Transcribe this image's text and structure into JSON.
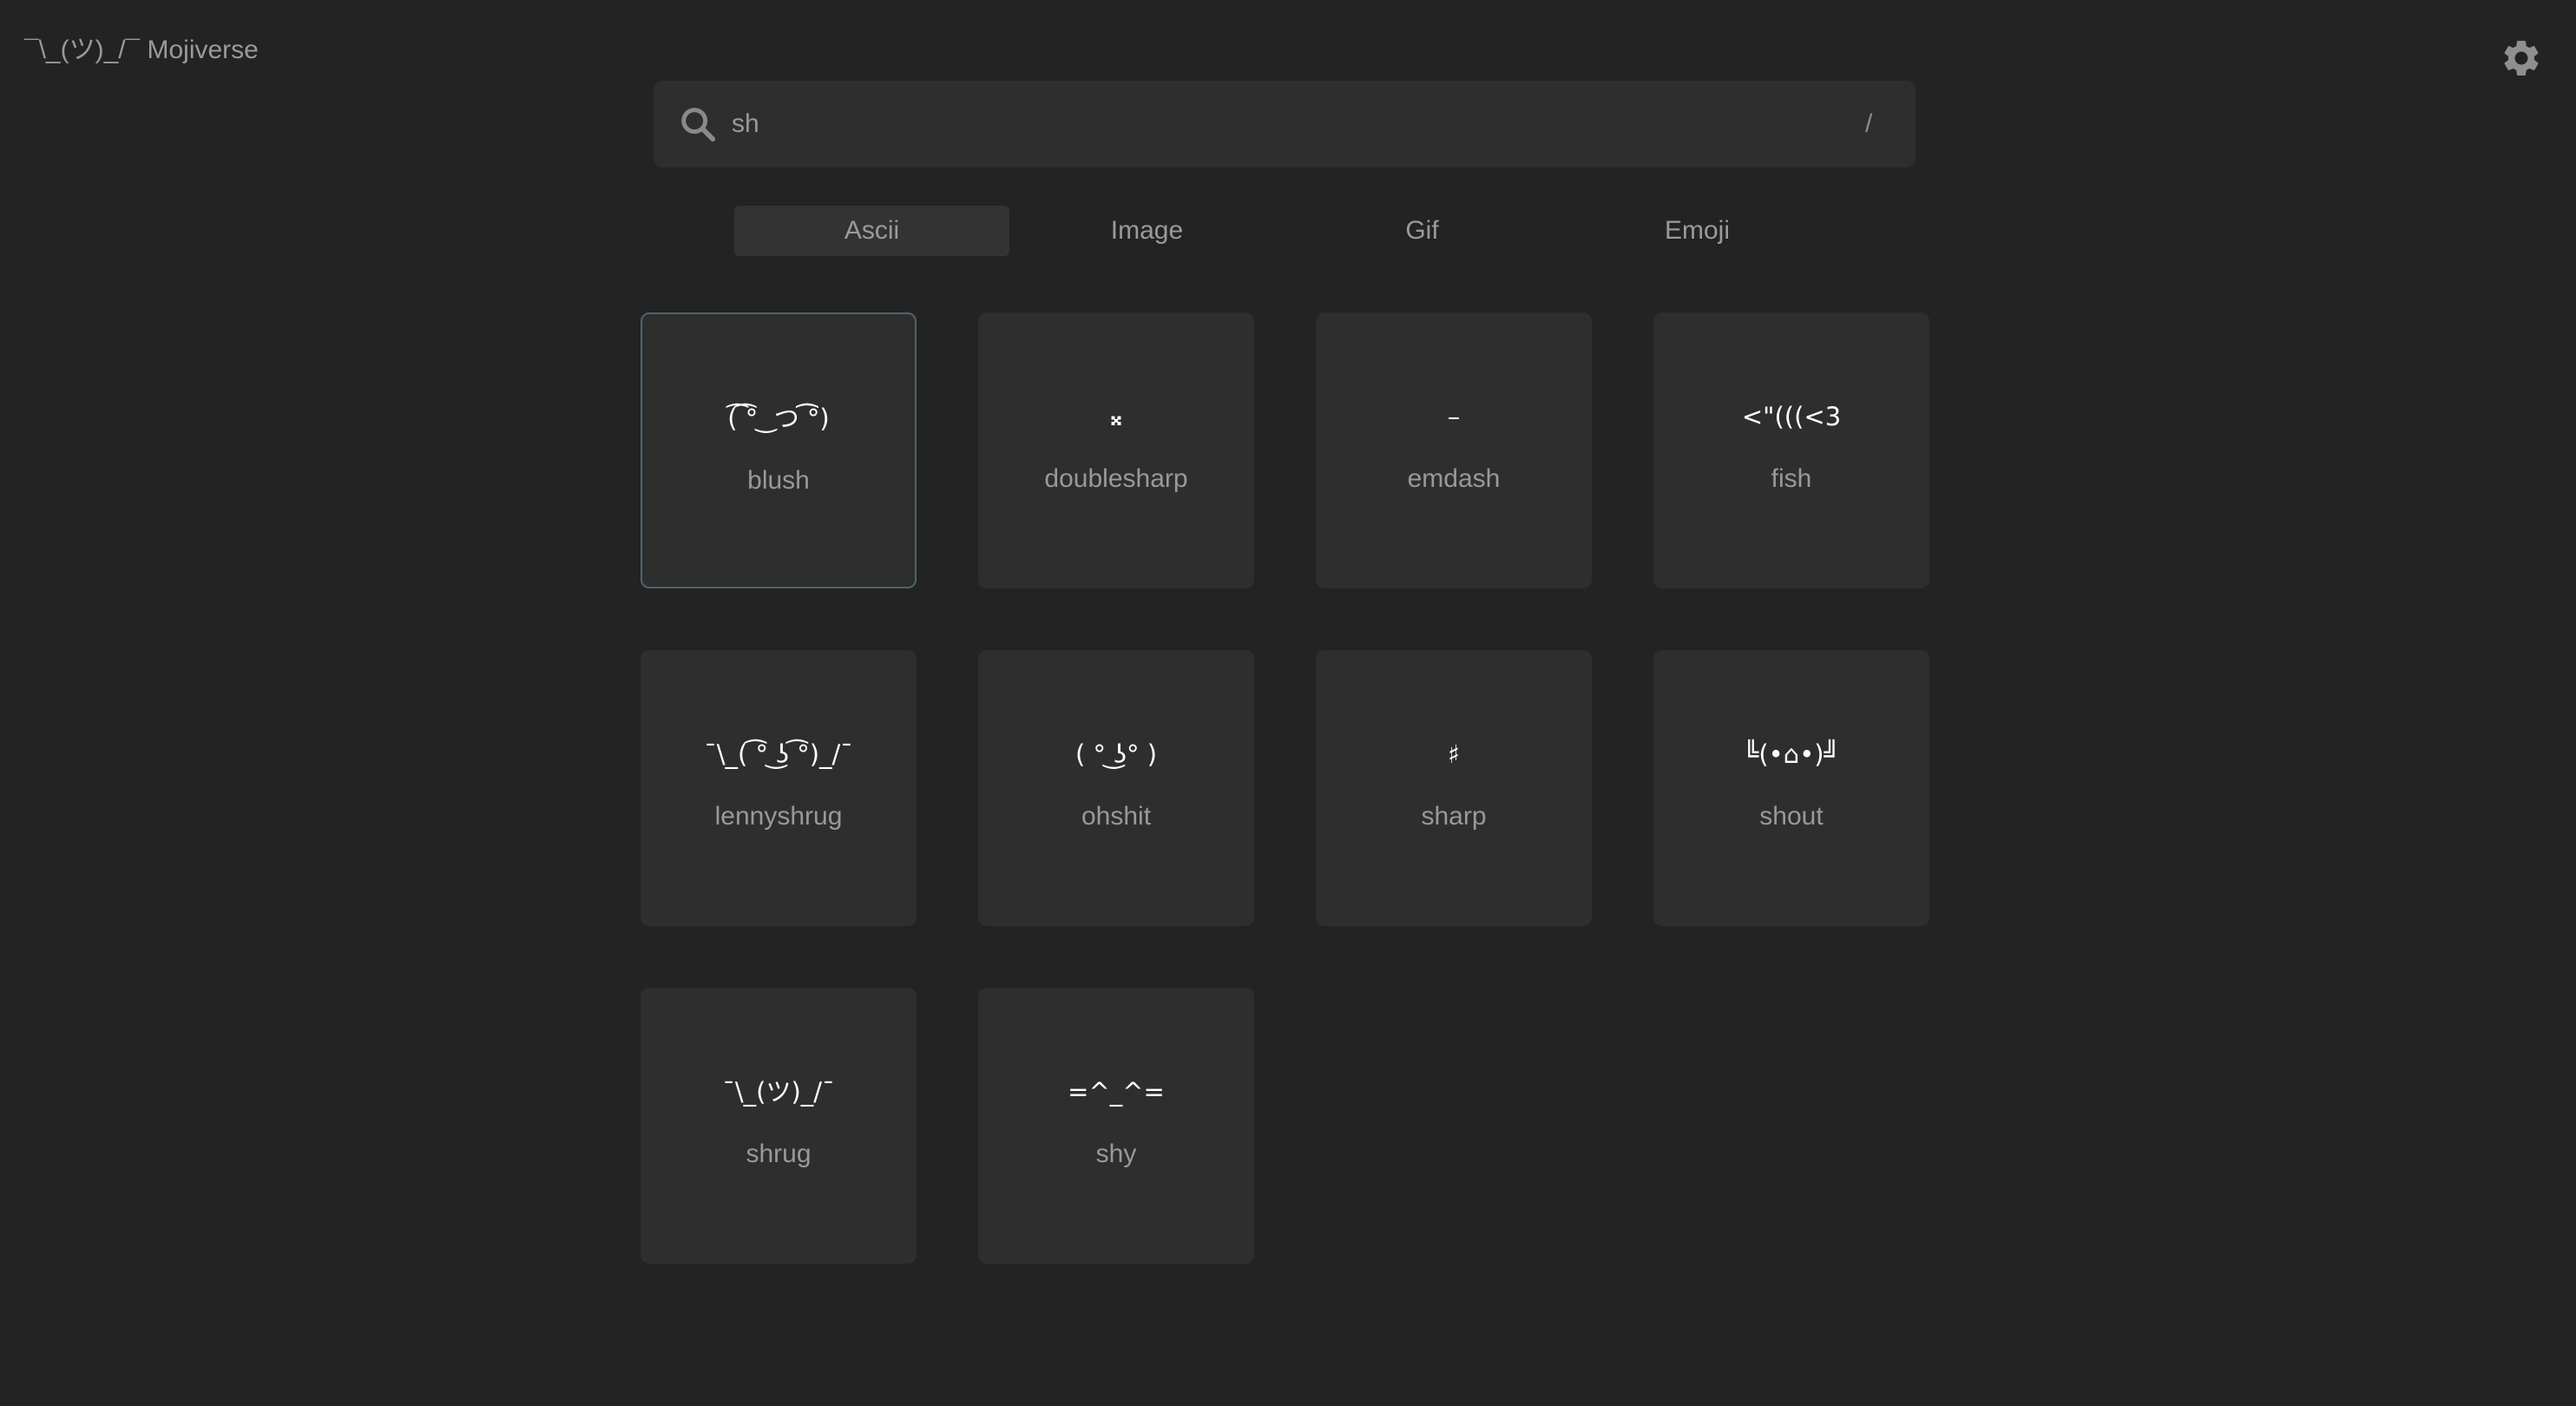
{
  "app": {
    "brand": "¯\\_(ツ)_/¯ Mojiverse"
  },
  "search": {
    "value": "sh",
    "shortcut": "/"
  },
  "tabs": [
    {
      "label": "Ascii",
      "active": true
    },
    {
      "label": "Image",
      "active": false
    },
    {
      "label": "Gif",
      "active": false
    },
    {
      "label": "Emoji",
      "active": false
    }
  ],
  "results": [
    {
      "glyph": "(͡ ͡° ͜ つ ͡͡°)",
      "name": "blush",
      "selected": true
    },
    {
      "glyph": "𝄪",
      "name": "doublesharp",
      "selected": false
    },
    {
      "glyph": "–",
      "name": "emdash",
      "selected": false
    },
    {
      "glyph": "<\"(((<3",
      "name": "fish",
      "selected": false
    },
    {
      "glyph": "¯\\_( ͡° ͜ʖ ͡°)_/¯",
      "name": "lennyshrug",
      "selected": false
    },
    {
      "glyph": "( ° ͜ʖ° )",
      "name": "ohshit",
      "selected": false
    },
    {
      "glyph": "♯",
      "name": "sharp",
      "selected": false
    },
    {
      "glyph": "╚(•⌂•)╝",
      "name": "shout",
      "selected": false
    },
    {
      "glyph": "¯\\_(ツ)_/¯",
      "name": "shrug",
      "selected": false
    },
    {
      "glyph": "=^_^=",
      "name": "shy",
      "selected": false
    }
  ],
  "colors": {
    "background": "#232323",
    "card": "#2e2e2e",
    "selected_border": "#4f6370",
    "active_tab": "#333333"
  }
}
